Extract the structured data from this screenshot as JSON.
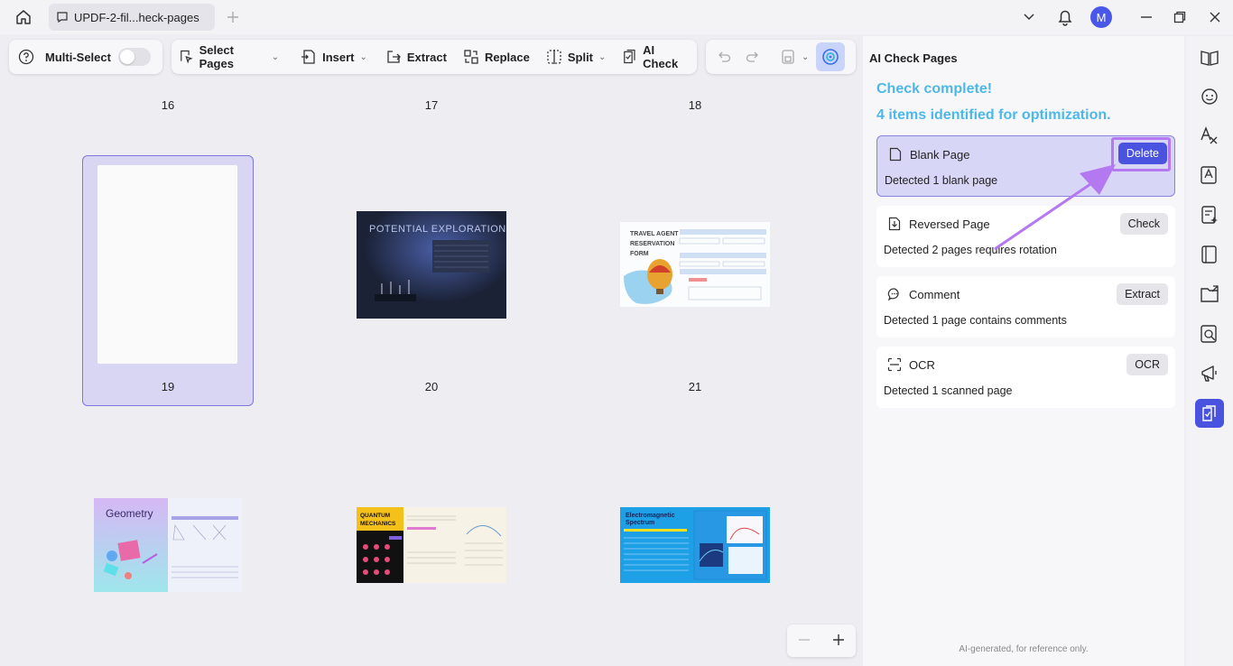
{
  "titlebar": {
    "tab_label": "UPDF-2-fil...heck-pages",
    "avatar_letter": "M"
  },
  "toolbar": {
    "multi_select": "Multi-Select",
    "select_pages": "Select Pages",
    "insert": "Insert",
    "extract": "Extract",
    "replace": "Replace",
    "split": "Split",
    "ai_check": "AI Check"
  },
  "pages": {
    "numbers": [
      "16",
      "17",
      "18",
      "19",
      "20",
      "21"
    ],
    "selected_page": "19",
    "thumb_potential_title": "POTENTIAL EXPLORATION",
    "thumb_travel_title": "TRAVEL AGENT RESERVATION FORM",
    "thumb_geometry_title": "Geometry",
    "thumb_quantum_title": "QUANTUM MECHANICS",
    "thumb_em_title": "Electromagnetic Spectrum"
  },
  "panel": {
    "title": "AI Check Pages",
    "status_line1": "Check complete!",
    "status_line2": "4 items identified for optimization.",
    "cards": [
      {
        "title": "Blank Page",
        "desc": "Detected 1 blank page",
        "action": "Delete"
      },
      {
        "title": "Reversed Page",
        "desc": "Detected 2 pages requires rotation",
        "action": "Check"
      },
      {
        "title": "Comment",
        "desc": "Detected 1 page contains comments",
        "action": "Extract"
      },
      {
        "title": "OCR",
        "desc": "Detected 1 scanned page",
        "action": "OCR"
      }
    ],
    "footnote": "AI-generated, for reference only."
  },
  "colors": {
    "accent": "#4a52e0",
    "highlight": "#b478f0",
    "status_blue": "#4db8e8",
    "selection": "#7f77dd"
  }
}
